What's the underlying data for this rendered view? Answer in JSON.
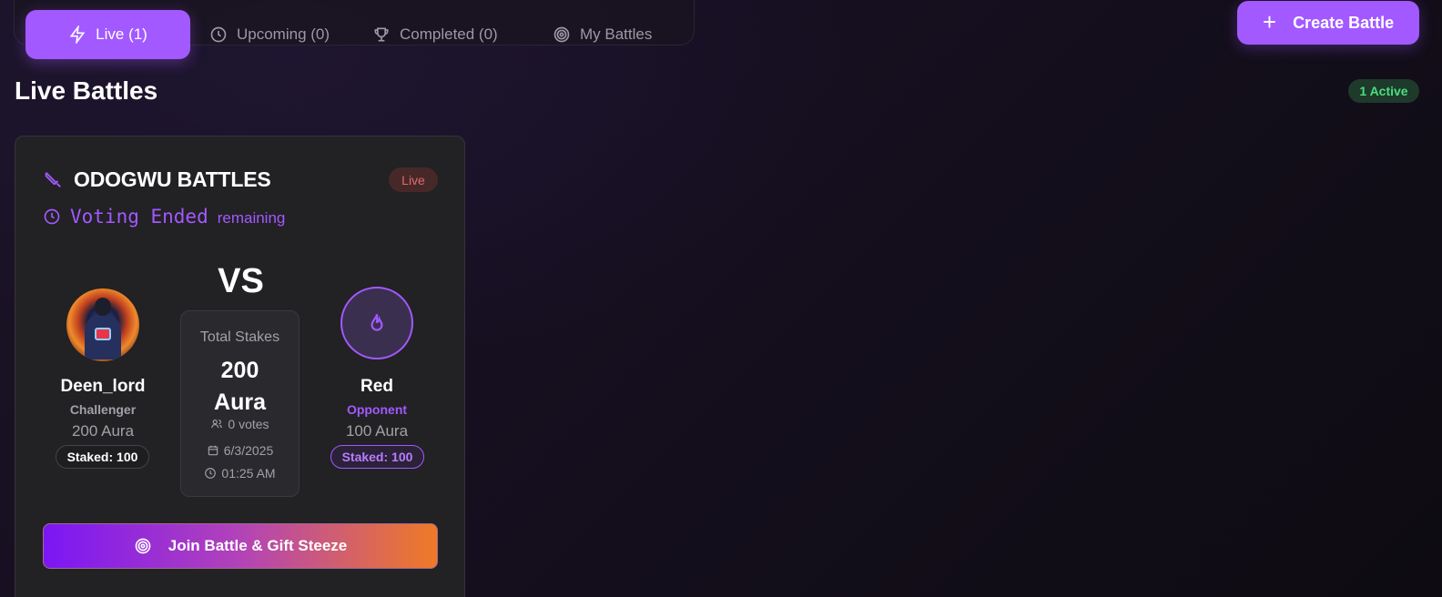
{
  "tabs": [
    {
      "label": "Live (1)",
      "icon": "bolt-icon",
      "active": true
    },
    {
      "label": "Upcoming (0)",
      "icon": "clock-icon"
    },
    {
      "label": "Completed (0)",
      "icon": "trophy-icon"
    },
    {
      "label": "My Battles",
      "icon": "target-icon"
    }
  ],
  "header": {
    "create_label": "Create Battle",
    "plus": "+"
  },
  "section": {
    "title": "Live Battles",
    "active_badge": "1 Active"
  },
  "colors": {
    "accent": "#a259ff",
    "live": "#e06a6a",
    "active": "#4ade80"
  },
  "card": {
    "title": "ODOGWU BATTLES",
    "status_badge": "Live",
    "voting_status": "Voting Ended",
    "voting_suffix": "remaining",
    "vs": "VS",
    "challenger": {
      "name": "Deen_lord",
      "role": "Challenger",
      "aura": "200 Aura",
      "staked": "Staked: 100"
    },
    "opponent": {
      "name": "Red",
      "role": "Opponent",
      "aura": "100 Aura",
      "staked": "Staked: 100"
    },
    "stakes": {
      "label": "Total Stakes",
      "amount": "200",
      "unit": "Aura",
      "votes": "0 votes",
      "date": "6/3/2025",
      "time": "01:25 AM"
    },
    "join_label": "Join Battle & Gift Steeze"
  }
}
